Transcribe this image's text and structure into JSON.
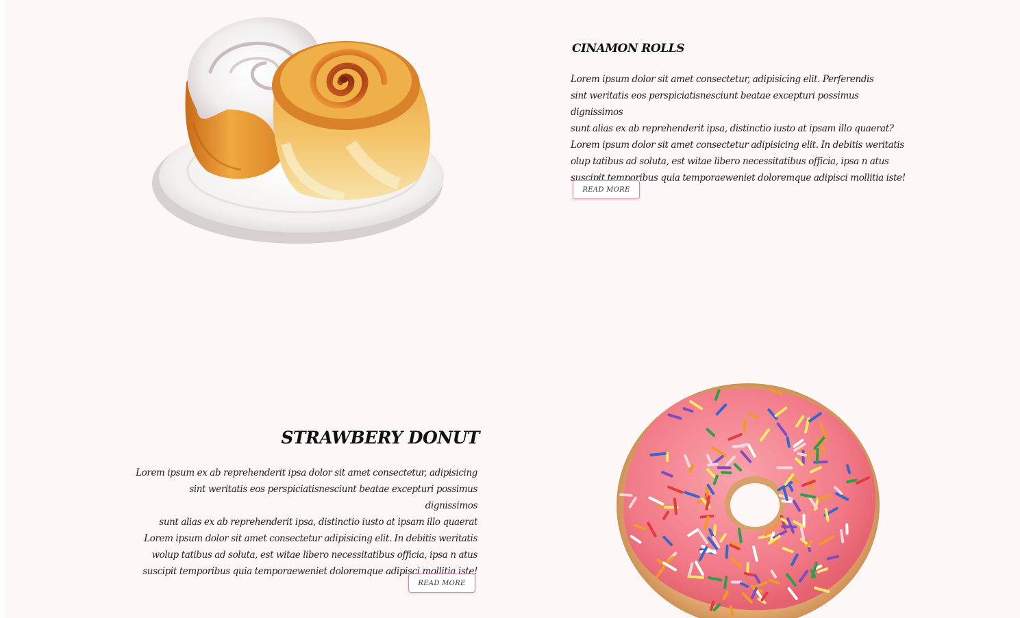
{
  "sections": [
    {
      "id": "cinnamon-rolls",
      "title": "CINAMON ROLLS",
      "description_lines": [
        "Lorem ipsum dolor sit amet consectetur, adipisicing elit. Perferendis",
        "sint weritatis eos perspiciatisnesciunt beatae excepturi possimus dignissimos",
        "sunt alias ex ab reprehenderit ipsa, distinctio iusto at  ipsam illo quaerat?",
        "Lorem ipsum dolor sit amet consectetur adipisicing elit. In debitis weritatis",
        "olup tatibus ad soluta, est witae libero necessitatibus officia, ipsa n atus",
        "suscipit temporibus quia temporaeweniet doloremque adipisci mollitia iste!"
      ],
      "button_label": "READ MORE",
      "image": "cinnamon-rolls-on-plate"
    },
    {
      "id": "strawberry-donut",
      "title": "STRAWBERY DONUT",
      "description_lines": [
        "Lorem ipsum ex ab reprehenderit ipsa dolor sit amet consectetur, adipisicing",
        "sint weritatis eos perspiciatisnesciunt beatae excepturi possimus dignissimos",
        "sunt alias ex ab reprehenderit ipsa, distinctio iusto at  ipsam illo quaerat",
        "Lorem ipsum dolor sit amet consectetur adipisicing elit. In debitis weritatis",
        "wolup tatibus ad soluta, est witae libero necessitatibus officia, ipsa n atus",
        "suscipit temporibus quia temporaeweniet doloremque adipisci mollitia iste!"
      ],
      "button_label": "READ MORE",
      "image": "pink-sprinkled-donut"
    }
  ],
  "colors": {
    "page_background": "#fdf8f7",
    "button_border": "#d8879b",
    "text": "#1f1f1f",
    "donut_frosting": "#f27b88"
  }
}
